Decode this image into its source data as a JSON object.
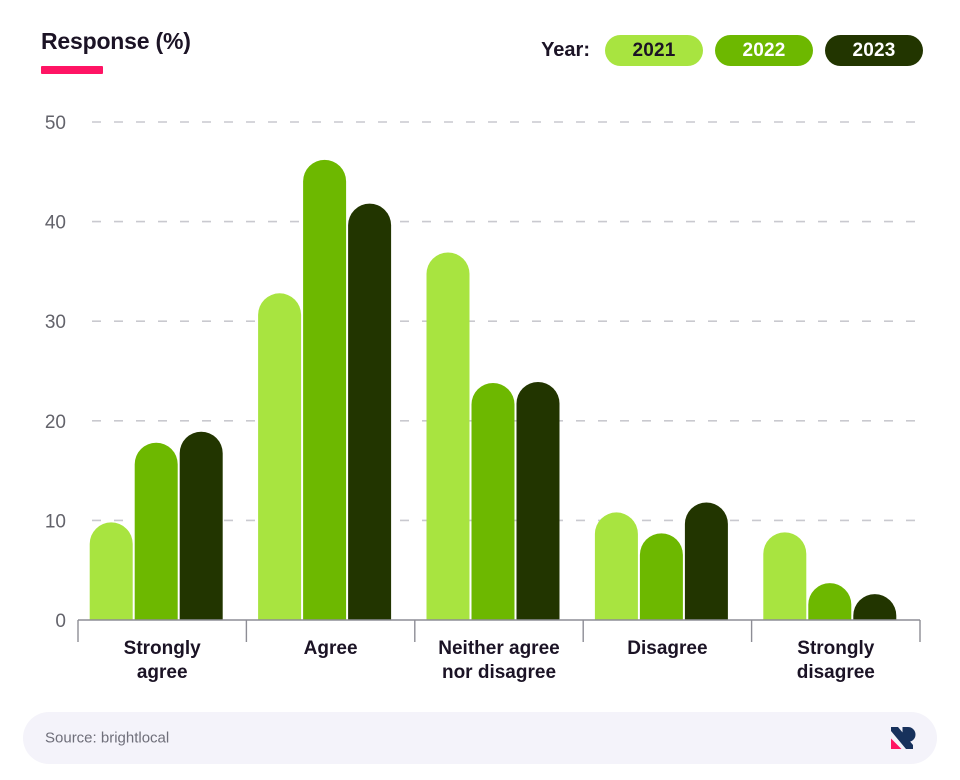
{
  "header": {
    "title": "Response (%)",
    "accent_color": "#ff1464",
    "legend": {
      "label": "Year:",
      "items": [
        {
          "label": "2021",
          "color": "#a8e440",
          "text_color": "#1b1325"
        },
        {
          "label": "2022",
          "color": "#6db800",
          "text_color": "#ffffff"
        },
        {
          "label": "2023",
          "color": "#223500",
          "text_color": "#ffffff"
        }
      ]
    }
  },
  "footer": {
    "source": "Source: brightlocal",
    "logo_name": "brightlocal-logo",
    "logo_colors": {
      "mark": "#17315c",
      "accent": "#ff1464"
    },
    "background": "#f4f3fa"
  },
  "chart_data": {
    "type": "bar",
    "title": "Response (%)",
    "xlabel": "",
    "ylabel": "Response (%)",
    "ylim": [
      0,
      50
    ],
    "yticks": [
      0,
      10,
      20,
      30,
      40,
      50
    ],
    "grid": true,
    "grid_style": "dashed-horizontal",
    "legend_position": "top-right",
    "categories": [
      "Strongly agree",
      "Agree",
      "Neither agree nor disagree",
      "Disagree",
      "Strongly disagree"
    ],
    "category_lines": [
      [
        "Strongly",
        "agree"
      ],
      [
        "Agree"
      ],
      [
        "Neither agree",
        "nor disagree"
      ],
      [
        "Disagree"
      ],
      [
        "Strongly",
        "disagree"
      ]
    ],
    "series": [
      {
        "name": "2021",
        "color": "#a8e440",
        "values": [
          9.8,
          32.8,
          36.9,
          10.8,
          8.8
        ]
      },
      {
        "name": "2022",
        "color": "#6db800",
        "values": [
          17.8,
          46.2,
          23.8,
          8.7,
          3.7
        ]
      },
      {
        "name": "2023",
        "color": "#223500",
        "values": [
          18.9,
          41.8,
          23.9,
          11.8,
          2.6
        ]
      }
    ]
  }
}
